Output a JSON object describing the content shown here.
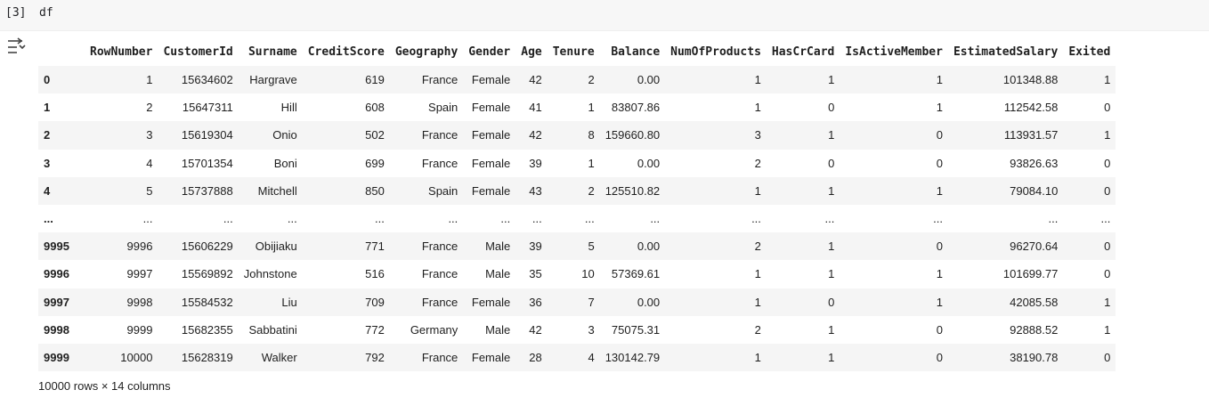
{
  "cell": {
    "execution_count": "[3]",
    "code": "df"
  },
  "table": {
    "columns": [
      "RowNumber",
      "CustomerId",
      "Surname",
      "CreditScore",
      "Geography",
      "Gender",
      "Age",
      "Tenure",
      "Balance",
      "NumOfProducts",
      "HasCrCard",
      "IsActiveMember",
      "EstimatedSalary",
      "Exited"
    ],
    "rows": [
      {
        "index": "0",
        "cells": [
          "1",
          "15634602",
          "Hargrave",
          "619",
          "France",
          "Female",
          "42",
          "2",
          "0.00",
          "1",
          "1",
          "1",
          "101348.88",
          "1"
        ]
      },
      {
        "index": "1",
        "cells": [
          "2",
          "15647311",
          "Hill",
          "608",
          "Spain",
          "Female",
          "41",
          "1",
          "83807.86",
          "1",
          "0",
          "1",
          "112542.58",
          "0"
        ]
      },
      {
        "index": "2",
        "cells": [
          "3",
          "15619304",
          "Onio",
          "502",
          "France",
          "Female",
          "42",
          "8",
          "159660.80",
          "3",
          "1",
          "0",
          "113931.57",
          "1"
        ]
      },
      {
        "index": "3",
        "cells": [
          "4",
          "15701354",
          "Boni",
          "699",
          "France",
          "Female",
          "39",
          "1",
          "0.00",
          "2",
          "0",
          "0",
          "93826.63",
          "0"
        ]
      },
      {
        "index": "4",
        "cells": [
          "5",
          "15737888",
          "Mitchell",
          "850",
          "Spain",
          "Female",
          "43",
          "2",
          "125510.82",
          "1",
          "1",
          "1",
          "79084.10",
          "0"
        ]
      },
      {
        "index": "...",
        "cells": [
          "...",
          "...",
          "...",
          "...",
          "...",
          "...",
          "...",
          "...",
          "...",
          "...",
          "...",
          "...",
          "...",
          "..."
        ]
      },
      {
        "index": "9995",
        "cells": [
          "9996",
          "15606229",
          "Obijiaku",
          "771",
          "France",
          "Male",
          "39",
          "5",
          "0.00",
          "2",
          "1",
          "0",
          "96270.64",
          "0"
        ]
      },
      {
        "index": "9996",
        "cells": [
          "9997",
          "15569892",
          "Johnstone",
          "516",
          "France",
          "Male",
          "35",
          "10",
          "57369.61",
          "1",
          "1",
          "1",
          "101699.77",
          "0"
        ]
      },
      {
        "index": "9997",
        "cells": [
          "9998",
          "15584532",
          "Liu",
          "709",
          "France",
          "Female",
          "36",
          "7",
          "0.00",
          "1",
          "0",
          "1",
          "42085.58",
          "1"
        ]
      },
      {
        "index": "9998",
        "cells": [
          "9999",
          "15682355",
          "Sabbatini",
          "772",
          "Germany",
          "Male",
          "42",
          "3",
          "75075.31",
          "2",
          "1",
          "0",
          "92888.52",
          "1"
        ]
      },
      {
        "index": "9999",
        "cells": [
          "10000",
          "15628319",
          "Walker",
          "792",
          "France",
          "Female",
          "28",
          "4",
          "130142.79",
          "1",
          "1",
          "0",
          "38190.78",
          "0"
        ]
      }
    ]
  },
  "footer": {
    "summary": "10000 rows × 14 columns"
  },
  "icons": {
    "output_toggle": "output-options-icon"
  }
}
